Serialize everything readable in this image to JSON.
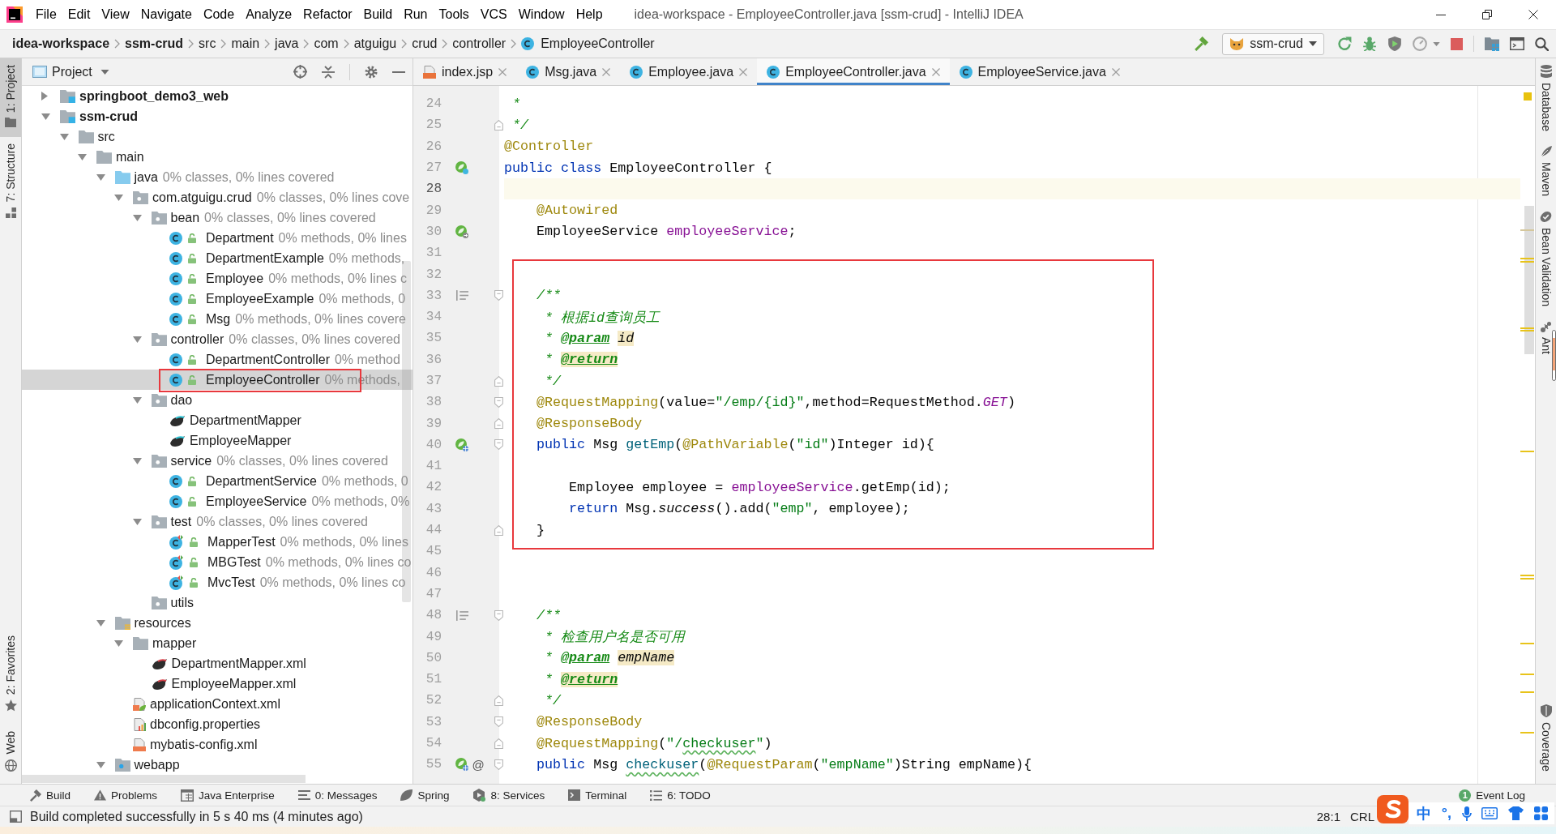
{
  "window": {
    "title": "idea-workspace - EmployeeController.java [ssm-crud] - IntelliJ IDEA",
    "menu": [
      "File",
      "Edit",
      "View",
      "Navigate",
      "Code",
      "Analyze",
      "Refactor",
      "Build",
      "Run",
      "Tools",
      "VCS",
      "Window",
      "Help"
    ]
  },
  "navigation": {
    "breadcrumbs": [
      {
        "label": "idea-workspace",
        "kind": "project"
      },
      {
        "label": "ssm-crud",
        "kind": "module"
      },
      {
        "label": "src",
        "kind": "folder"
      },
      {
        "label": "main",
        "kind": "folder"
      },
      {
        "label": "java",
        "kind": "folder"
      },
      {
        "label": "com",
        "kind": "folder"
      },
      {
        "label": "atguigu",
        "kind": "folder"
      },
      {
        "label": "crud",
        "kind": "folder"
      },
      {
        "label": "controller",
        "kind": "folder"
      },
      {
        "label": "EmployeeController",
        "kind": "class"
      }
    ],
    "run_config": "ssm-crud"
  },
  "left_stripe": {
    "top": [
      {
        "label": "1: Project",
        "kind": "project",
        "selected": true
      },
      {
        "label": "7: Structure",
        "kind": "structure",
        "selected": false
      }
    ],
    "bottom": [
      {
        "label": "2: Favorites",
        "kind": "favorites",
        "selected": false
      },
      {
        "label": "Web",
        "kind": "web",
        "selected": false
      }
    ]
  },
  "project": {
    "title": "Project",
    "tree": [
      {
        "name": "springboot_demo3_web",
        "kind": "module",
        "expanded": false,
        "selected": false
      },
      {
        "name": "ssm-crud",
        "kind": "module",
        "expanded": true,
        "selected": false,
        "children": [
          {
            "name": "src",
            "kind": "folder",
            "expanded": true,
            "selected": false,
            "children": [
              {
                "name": "main",
                "kind": "folder",
                "expanded": true,
                "selected": false,
                "children": [
                  {
                    "name": "java",
                    "kind": "source-folder",
                    "coverage": "0% classes, 0% lines covered",
                    "expanded": true,
                    "selected": false,
                    "children": [
                      {
                        "name": "com.atguigu.crud",
                        "kind": "package",
                        "coverage": "0% classes, 0% lines cove",
                        "expanded": true,
                        "selected": false,
                        "children": [
                          {
                            "name": "bean",
                            "kind": "package",
                            "coverage": "0% classes, 0% lines covered",
                            "expanded": true,
                            "selected": false,
                            "children": [
                              {
                                "name": "Department",
                                "kind": "class",
                                "coverage": "0% methods, 0% lines",
                                "selected": false
                              },
                              {
                                "name": "DepartmentExample",
                                "kind": "class",
                                "coverage": "0% methods,",
                                "selected": false
                              },
                              {
                                "name": "Employee",
                                "kind": "class",
                                "coverage": "0% methods, 0% lines c",
                                "selected": false
                              },
                              {
                                "name": "EmployeeExample",
                                "kind": "class",
                                "coverage": "0% methods, 0",
                                "selected": false
                              },
                              {
                                "name": "Msg",
                                "kind": "class",
                                "coverage": "0% methods, 0% lines covere",
                                "selected": false
                              }
                            ]
                          },
                          {
                            "name": "controller",
                            "kind": "package",
                            "coverage": "0% classes, 0% lines covered",
                            "expanded": true,
                            "selected": false,
                            "children": [
                              {
                                "name": "DepartmentController",
                                "kind": "class",
                                "coverage": "0% method",
                                "selected": false
                              },
                              {
                                "name": "EmployeeController",
                                "kind": "class",
                                "coverage": "0% methods,",
                                "selected": true,
                                "framed": true
                              }
                            ]
                          },
                          {
                            "name": "dao",
                            "kind": "package",
                            "expanded": true,
                            "selected": false,
                            "children": [
                              {
                                "name": "DepartmentMapper",
                                "kind": "mapper",
                                "selected": false
                              },
                              {
                                "name": "EmployeeMapper",
                                "kind": "mapper",
                                "selected": false
                              }
                            ]
                          },
                          {
                            "name": "service",
                            "kind": "package",
                            "coverage": "0% classes, 0% lines covered",
                            "expanded": true,
                            "selected": false,
                            "children": [
                              {
                                "name": "DepartmentService",
                                "kind": "class",
                                "coverage": "0% methods, 0",
                                "selected": false
                              },
                              {
                                "name": "EmployeeService",
                                "kind": "class",
                                "coverage": "0% methods, 0%",
                                "selected": false
                              }
                            ]
                          },
                          {
                            "name": "test",
                            "kind": "package",
                            "coverage": "0% classes, 0% lines covered",
                            "expanded": true,
                            "selected": false,
                            "children": [
                              {
                                "name": "MapperTest",
                                "kind": "test-class",
                                "coverage": "0% methods, 0% lines",
                                "selected": false
                              },
                              {
                                "name": "MBGTest",
                                "kind": "test-class",
                                "coverage": "0% methods, 0% lines co",
                                "selected": false
                              },
                              {
                                "name": "MvcTest",
                                "kind": "test-class",
                                "coverage": "0% methods, 0% lines co",
                                "selected": false
                              }
                            ]
                          },
                          {
                            "name": "utils",
                            "kind": "package",
                            "selected": false
                          }
                        ]
                      }
                    ]
                  },
                  {
                    "name": "resources",
                    "kind": "resources-folder",
                    "expanded": true,
                    "selected": false,
                    "children": [
                      {
                        "name": "mapper",
                        "kind": "folder",
                        "expanded": true,
                        "selected": false,
                        "children": [
                          {
                            "name": "DepartmentMapper.xml",
                            "kind": "mapper-xml",
                            "selected": false
                          },
                          {
                            "name": "EmployeeMapper.xml",
                            "kind": "mapper-xml",
                            "selected": false
                          }
                        ]
                      },
                      {
                        "name": "applicationContext.xml",
                        "kind": "spring-xml",
                        "selected": false
                      },
                      {
                        "name": "dbconfig.properties",
                        "kind": "properties",
                        "selected": false
                      },
                      {
                        "name": "mybatis-config.xml",
                        "kind": "xml",
                        "selected": false
                      }
                    ]
                  },
                  {
                    "name": "webapp",
                    "kind": "web-folder",
                    "expanded": true,
                    "selected": false
                  }
                ]
              }
            ]
          }
        ]
      }
    ]
  },
  "tabs": [
    {
      "label": "index.jsp",
      "kind": "jsp",
      "selected": false
    },
    {
      "label": "Msg.java",
      "kind": "class",
      "selected": false
    },
    {
      "label": "Employee.java",
      "kind": "class",
      "selected": false
    },
    {
      "label": "EmployeeController.java",
      "kind": "class",
      "selected": true
    },
    {
      "label": "EmployeeService.java",
      "kind": "class",
      "selected": false
    }
  ],
  "editor": {
    "blocks": [
      {
        "framed": false,
        "lines": [
          {
            "number": "24",
            "tokens": [
              {
                "text": " *",
                "kind": "comment"
              }
            ]
          },
          {
            "number": "25",
            "tokens": [
              {
                "text": " */",
                "kind": "comment"
              }
            ],
            "gutter": [
              {
                "kind": "fold-end"
              }
            ]
          },
          {
            "number": "26",
            "tokens": [
              {
                "text": "@Controller",
                "kind": "annotation"
              }
            ]
          },
          {
            "number": "27",
            "tokens": [
              {
                "text": "public class",
                "kind": "keyword"
              },
              {
                "text": " EmployeeController {",
                "kind": "plain"
              }
            ],
            "gutter": [
              {
                "kind": "bean"
              }
            ]
          },
          {
            "number": "28",
            "current": true
          },
          {
            "number": "29",
            "tokens": [
              {
                "text": "    @Autowired",
                "kind": "annotation"
              }
            ]
          },
          {
            "number": "30",
            "tokens": [
              {
                "text": "    EmployeeService ",
                "kind": "plain"
              },
              {
                "text": "employeeService",
                "kind": "field"
              },
              {
                "text": ";",
                "kind": "plain"
              }
            ],
            "gutter": [
              {
                "kind": "autowired"
              }
            ]
          },
          {
            "number": "31"
          }
        ]
      },
      {
        "framed": true,
        "lines": [
          {
            "number": "32"
          },
          {
            "number": "33",
            "tokens": [
              {
                "text": "    /**",
                "kind": "comment"
              }
            ],
            "gutter": [
              {
                "kind": "doc"
              },
              {
                "kind": "fold-start"
              }
            ]
          },
          {
            "number": "34",
            "tokens": [
              {
                "text": "     * 根据id查询员工",
                "kind": "comment"
              }
            ]
          },
          {
            "number": "35",
            "tokens": [
              {
                "text": "     * ",
                "kind": "comment"
              },
              {
                "text": "@param ",
                "kind": "doc-tag"
              },
              {
                "text": "id",
                "kind": "doc-value",
                "highlighted": true
              }
            ]
          },
          {
            "number": "36",
            "tokens": [
              {
                "text": "     * ",
                "kind": "comment"
              },
              {
                "text": "@return",
                "kind": "doc-tag",
                "highlighted": true
              }
            ]
          },
          {
            "number": "37",
            "tokens": [
              {
                "text": "     */",
                "kind": "comment"
              }
            ],
            "gutter": [
              {
                "kind": "fold-end"
              }
            ]
          },
          {
            "number": "38",
            "tokens": [
              {
                "text": "    @RequestMapping",
                "kind": "annotation"
              },
              {
                "text": "(value=",
                "kind": "plain"
              },
              {
                "text": "\"/emp/{id}\"",
                "kind": "string"
              },
              {
                "text": ",method=RequestMethod.",
                "kind": "plain"
              },
              {
                "text": "GET",
                "kind": "constant"
              },
              {
                "text": ")",
                "kind": "plain"
              }
            ],
            "gutter": [
              {
                "kind": "fold-start"
              }
            ]
          },
          {
            "number": "39",
            "tokens": [
              {
                "text": "    @ResponseBody",
                "kind": "annotation"
              }
            ],
            "gutter": [
              {
                "kind": "fold-end"
              }
            ]
          },
          {
            "number": "40",
            "tokens": [
              {
                "text": "    public",
                "kind": "keyword"
              },
              {
                "text": " Msg ",
                "kind": "plain"
              },
              {
                "text": "getEmp",
                "kind": "method"
              },
              {
                "text": "(",
                "kind": "plain"
              },
              {
                "text": "@PathVariable",
                "kind": "annotation"
              },
              {
                "text": "(",
                "kind": "plain"
              },
              {
                "text": "\"id\"",
                "kind": "string"
              },
              {
                "text": ")Integer id){",
                "kind": "plain"
              }
            ],
            "gutter": [
              {
                "kind": "mapping"
              },
              {
                "kind": "fold-start"
              }
            ]
          },
          {
            "number": "41"
          },
          {
            "number": "42",
            "tokens": [
              {
                "text": "        Employee employee = ",
                "kind": "plain"
              },
              {
                "text": "employeeService",
                "kind": "field"
              },
              {
                "text": ".getEmp(id);",
                "kind": "plain"
              }
            ]
          },
          {
            "number": "43",
            "tokens": [
              {
                "text": "        return",
                "kind": "keyword"
              },
              {
                "text": " Msg.",
                "kind": "plain"
              },
              {
                "text": "success",
                "kind": "static"
              },
              {
                "text": "().add(",
                "kind": "plain"
              },
              {
                "text": "\"emp\"",
                "kind": "string"
              },
              {
                "text": ", employee);",
                "kind": "plain"
              }
            ]
          },
          {
            "number": "44",
            "tokens": [
              {
                "text": "    }",
                "kind": "plain"
              }
            ],
            "gutter": [
              {
                "kind": "fold-end"
              }
            ]
          }
        ]
      },
      {
        "framed": false,
        "lines": [
          {
            "number": "45"
          },
          {
            "number": "46"
          },
          {
            "number": "47"
          },
          {
            "number": "48",
            "tokens": [
              {
                "text": "    /**",
                "kind": "comment"
              }
            ],
            "gutter": [
              {
                "kind": "doc"
              },
              {
                "kind": "fold-start"
              }
            ]
          },
          {
            "number": "49",
            "tokens": [
              {
                "text": "     * 检查用户名是否可用",
                "kind": "comment"
              }
            ]
          },
          {
            "number": "50",
            "tokens": [
              {
                "text": "     * ",
                "kind": "comment"
              },
              {
                "text": "@param ",
                "kind": "doc-tag"
              },
              {
                "text": "empName",
                "kind": "doc-value",
                "highlighted": true
              }
            ]
          },
          {
            "number": "51",
            "tokens": [
              {
                "text": "     * ",
                "kind": "comment"
              },
              {
                "text": "@return",
                "kind": "doc-tag",
                "highlighted": true
              }
            ]
          },
          {
            "number": "52",
            "tokens": [
              {
                "text": "     */",
                "kind": "comment"
              }
            ],
            "gutter": [
              {
                "kind": "fold-end"
              }
            ]
          },
          {
            "number": "53",
            "tokens": [
              {
                "text": "    @ResponseBody",
                "kind": "annotation"
              }
            ],
            "gutter": [
              {
                "kind": "fold-start"
              }
            ]
          },
          {
            "number": "54",
            "tokens": [
              {
                "text": "    @RequestMapping",
                "kind": "annotation"
              },
              {
                "text": "(",
                "kind": "plain"
              },
              {
                "text": "\"/",
                "kind": "string"
              },
              {
                "text": "checkuser",
                "kind": "string",
                "typo": true
              },
              {
                "text": "\"",
                "kind": "string"
              },
              {
                "text": ")",
                "kind": "plain"
              }
            ],
            "gutter": [
              {
                "kind": "fold-end"
              }
            ]
          },
          {
            "number": "55",
            "tokens": [
              {
                "text": "    public",
                "kind": "keyword"
              },
              {
                "text": " Msg ",
                "kind": "plain"
              },
              {
                "text": "checkuser",
                "kind": "method",
                "typo": true
              },
              {
                "text": "(",
                "kind": "plain"
              },
              {
                "text": "@RequestParam",
                "kind": "annotation"
              },
              {
                "text": "(",
                "kind": "plain"
              },
              {
                "text": "\"empName\"",
                "kind": "string"
              },
              {
                "text": ")String empName){",
                "kind": "plain"
              }
            ],
            "gutter": [
              {
                "kind": "mapping"
              },
              {
                "kind": "glyph",
                "text": "@"
              },
              {
                "kind": "fold-start"
              }
            ]
          }
        ]
      }
    ]
  },
  "right_stripe": {
    "top": [
      {
        "label": "Database",
        "kind": "database",
        "selected": false
      },
      {
        "label": "Maven",
        "kind": "maven",
        "selected": false
      },
      {
        "label": "Bean Validation",
        "kind": "bean-validation",
        "selected": false
      },
      {
        "label": "Ant",
        "kind": "ant",
        "selected": false
      }
    ],
    "bottom": [
      {
        "label": "Coverage",
        "kind": "coverage",
        "selected": false
      }
    ]
  },
  "bottom_tools": [
    {
      "label": "Build",
      "kind": "build",
      "selected": false
    },
    {
      "label": "Problems",
      "kind": "problems",
      "selected": false
    },
    {
      "label": "Java Enterprise",
      "kind": "java-enterprise",
      "selected": false
    },
    {
      "label": "0: Messages",
      "kind": "messages",
      "selected": false
    },
    {
      "label": "Spring",
      "kind": "spring",
      "selected": false
    },
    {
      "label": "8: Services",
      "kind": "services",
      "selected": false
    },
    {
      "label": "Terminal",
      "kind": "terminal",
      "selected": false
    },
    {
      "label": "6: TODO",
      "kind": "todo",
      "selected": false
    }
  ],
  "event_log": {
    "label": "Event Log",
    "count": "1"
  },
  "status_bar": {
    "message": "Build completed successfully in 5 s 40 ms (4 minutes ago)",
    "position": "28:1",
    "line_separator": "CRL"
  },
  "ime": {
    "mode": "中",
    "punctuation": "°,"
  }
}
